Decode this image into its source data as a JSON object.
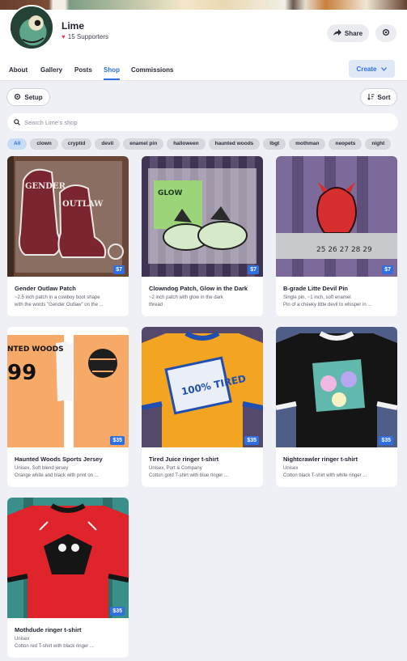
{
  "creator": {
    "name": "Lime",
    "supporters": "15 Supporters"
  },
  "header": {
    "share_label": "Share"
  },
  "tabs": [
    {
      "label": "About"
    },
    {
      "label": "Gallery"
    },
    {
      "label": "Posts"
    },
    {
      "label": "Shop"
    },
    {
      "label": "Commissions"
    }
  ],
  "active_tab": "Shop",
  "create_label": "Create",
  "toolbar": {
    "setup_label": "Setup",
    "sort_label": "Sort"
  },
  "search": {
    "placeholder": "Search Lime's shop"
  },
  "chips": [
    {
      "label": "All"
    },
    {
      "label": "clown"
    },
    {
      "label": "cryptid"
    },
    {
      "label": "devil"
    },
    {
      "label": "enamel pin"
    },
    {
      "label": "halloween"
    },
    {
      "label": "haunted woods"
    },
    {
      "label": "lbgt"
    },
    {
      "label": "mothman"
    },
    {
      "label": "neopets"
    },
    {
      "label": "night"
    }
  ],
  "products": [
    {
      "title": "Gender Outlaw Patch",
      "price": "$7",
      "desc1": "~2.5 inch patch in a cowboy boot shape",
      "desc2": "with the words \"Gender Outlaw\" on the ..."
    },
    {
      "title": "Clowndog Patch, Glow in the Dark",
      "price": "$7",
      "desc1": "~2 inch patch with glow in the dark",
      "desc2": "thread"
    },
    {
      "title": "B-grade Litte Devil Pin",
      "price": "$7",
      "desc1": "Single pin, ~1 inch, soft enamel",
      "desc2": "Pin of a cheeky little devil to whisper in ..."
    },
    {
      "title": "Haunted Woods Sports Jersey",
      "price": "$35",
      "desc1": "Unisex, Soft blend jersey",
      "desc2": "Orange white and black with print on ..."
    },
    {
      "title": "Tired Juice ringer t-shirt",
      "price": "$35",
      "desc1": "Unisex, Port & Company",
      "desc2": "Cotton gold T-shirt with blue ringer ..."
    },
    {
      "title": "Nightcrawler ringer t-shirt",
      "price": "$35",
      "desc1": "Unisex",
      "desc2": "Cotton black T-shirt with white ringer ..."
    },
    {
      "title": "Mothdude ringer t-shirt",
      "price": "$35",
      "desc1": "Unisex",
      "desc2": "Cotton red T-shirt with black ringer ..."
    }
  ],
  "image_text": {
    "patch": "GENDER OUTLAW",
    "clowndog": "GLOW",
    "ruler": "25 26 27 28 29",
    "jersey_back": "99",
    "jersey_woods": "NTED WOODS",
    "tired": "100% TIRED"
  },
  "colors": {
    "accent": "#2f6fe0",
    "heart": "#e0465a",
    "price_badge": "#2f6fe0"
  }
}
